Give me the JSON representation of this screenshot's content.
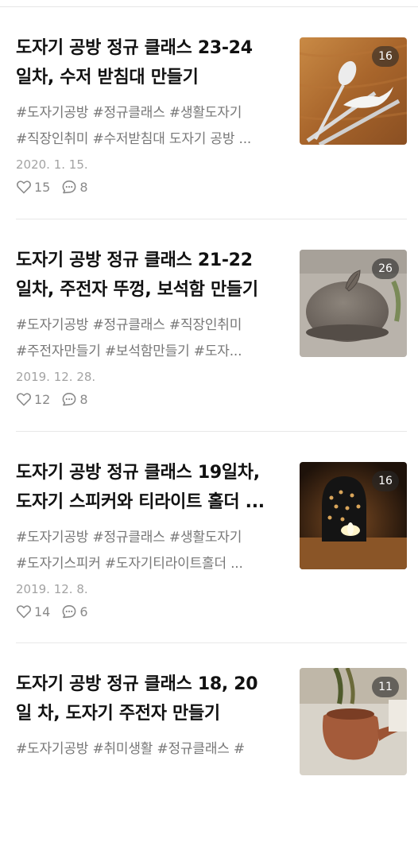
{
  "posts": [
    {
      "title_lines": [
        "도자기 공방 정규 클래스 23-24",
        "일차, 수저 받침대 만들기"
      ],
      "tag_lines": [
        "#도자기공방 #정규클래스 #생활도자기",
        "#직장인취미 #수저받침대 도자기 공방 ..."
      ],
      "date": "2020. 1. 15.",
      "likes": "15",
      "comments": "8",
      "photo_count": "16"
    },
    {
      "title_lines": [
        "도자기 공방 정규 클래스 21-22",
        "일차, 주전자 뚜껑, 보석함 만들기"
      ],
      "tag_lines": [
        "#도자기공방 #정규클래스 #직장인취미",
        "#주전자만들기 #보석함만들기 #도자..."
      ],
      "date": "2019. 12. 28.",
      "likes": "12",
      "comments": "8",
      "photo_count": "26"
    },
    {
      "title_lines": [
        "도자기 공방 정규 클래스 19일차,",
        "도자기 스피커와 티라이트 홀더 ..."
      ],
      "tag_lines": [
        "#도자기공방 #정규클래스 #생활도자기",
        "#도자기스피커 #도자기티라이트홀더 ..."
      ],
      "date": "2019. 12. 8.",
      "likes": "14",
      "comments": "6",
      "photo_count": "16"
    },
    {
      "title_lines": [
        "도자기 공방 정규 클래스 18, 20",
        "일 차, 도자기 주전자 만들기"
      ],
      "tag_lines": [
        "#도자기공방 #취미생활 #정규클래스 #",
        ""
      ],
      "date": "",
      "likes": "",
      "comments": "",
      "photo_count": "11"
    }
  ],
  "icons": {
    "like": "heart-outline-icon",
    "comment": "speech-bubble-dots-icon"
  },
  "colors": {
    "title": "#111111",
    "tags": "#777777",
    "date": "#a3a3a3",
    "meta": "#8a8a8a",
    "badge_bg": "rgba(40,40,40,0.6)"
  }
}
